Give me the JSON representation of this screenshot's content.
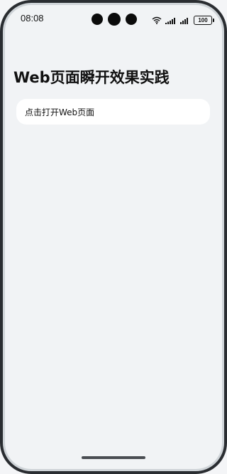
{
  "status_bar": {
    "time": "08:08",
    "battery_level": "100",
    "icons": [
      "wifi-icon",
      "signal-icon",
      "signal-icon",
      "battery-icon"
    ]
  },
  "page": {
    "title": "Web页面瞬开效果实践",
    "open_button_label": "点击打开Web页面"
  }
}
